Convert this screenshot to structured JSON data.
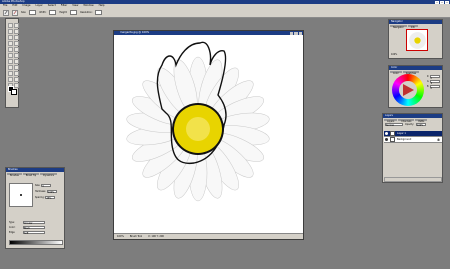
{
  "app": {
    "title": "Adobe Photoshop"
  },
  "menu": [
    "File",
    "Edit",
    "Image",
    "Layer",
    "Select",
    "Filter",
    "View",
    "Window",
    "Help"
  ],
  "options": {
    "labels": [
      "Size:",
      "Width:",
      "Height:",
      "Resolution:"
    ]
  },
  "document": {
    "title": "margarita.jpg @ 100%",
    "status_zoom": "100%",
    "status_info": "Brush Tool",
    "status_coords": "X: 100  Y: 200"
  },
  "navigator": {
    "title": "Navigator",
    "tabs": [
      "Navigator",
      "Info"
    ],
    "zoom": "100%"
  },
  "color_panel": {
    "title": "Color",
    "tabs": [
      "Color",
      "Swatches"
    ],
    "channels": [
      {
        "label": "R",
        "value": "0"
      },
      {
        "label": "G",
        "value": "0"
      },
      {
        "label": "B",
        "value": "0"
      }
    ]
  },
  "layers": {
    "title": "Layers",
    "tabs": [
      "Layers",
      "Channels",
      "Paths"
    ],
    "mode": "Normal",
    "opacity_label": "Opacity:",
    "opacity": "100%",
    "rows": [
      {
        "name": "Layer 1",
        "selected": true
      },
      {
        "name": "Background",
        "selected": false
      }
    ]
  },
  "brushes": {
    "title": "Brushes",
    "tabs": [
      "Brushes",
      "Brush Tip",
      "Dynamics"
    ],
    "fields": [
      {
        "label": "Size:",
        "value": "3"
      },
      {
        "label": "Hardness:",
        "value": "100%"
      },
      {
        "label": "Spacing:",
        "value": "25%"
      }
    ],
    "footer_labels": [
      "Type:",
      "Color:",
      "Edge:"
    ],
    "footer_values": [
      "Circular",
      "Black",
      "Soft"
    ]
  },
  "colors": {
    "title_blue": "#1c3c84",
    "panel_gray": "#d4d0c8",
    "workspace": "#7d7d7d",
    "selection": "#0a246a",
    "flower_center": "#e8d400"
  }
}
